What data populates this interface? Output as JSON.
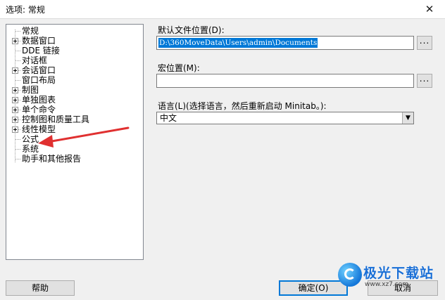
{
  "window": {
    "title": "选项: 常规",
    "close_glyph": "✕"
  },
  "tree": {
    "items": [
      {
        "label": "常规",
        "expandable": false
      },
      {
        "label": "数据窗口",
        "expandable": true
      },
      {
        "label": "DDE 链接",
        "expandable": false
      },
      {
        "label": "对话框",
        "expandable": false
      },
      {
        "label": "会话窗口",
        "expandable": true
      },
      {
        "label": "窗口布局",
        "expandable": false
      },
      {
        "label": "制图",
        "expandable": true
      },
      {
        "label": "单独图表",
        "expandable": true
      },
      {
        "label": "单个命令",
        "expandable": true
      },
      {
        "label": "控制图和质量工具",
        "expandable": true
      },
      {
        "label": "线性模型",
        "expandable": true
      },
      {
        "label": "公式",
        "expandable": false
      },
      {
        "label": "系统",
        "expandable": false
      },
      {
        "label": "助手和其他报告",
        "expandable": false
      }
    ]
  },
  "settings": {
    "default_location_label": "默认文件位置(D):",
    "default_location_value": "D:\\360MoveData\\Users\\admin\\Documents",
    "macro_location_label": "宏位置(M):",
    "macro_location_value": "",
    "browse_label": "...",
    "language_label": "语言(L)(选择语言，然后重新启动 Minitab。):",
    "language_value": "中文"
  },
  "buttons": {
    "help": "帮助",
    "ok": "确定(O)",
    "cancel": "取消"
  },
  "watermark": {
    "text": "极光下载站",
    "url": "www.xz7.com"
  },
  "colors": {
    "selection": "#0078d7",
    "annotation_arrow": "#e03030",
    "watermark": "#1a6fd6"
  }
}
